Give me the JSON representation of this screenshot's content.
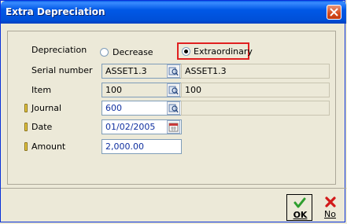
{
  "window": {
    "title": "Extra Depreciation"
  },
  "depreciation": {
    "label": "Depreciation",
    "options": [
      "Decrease",
      "Extraordinary"
    ],
    "selected": "Extraordinary"
  },
  "fields": {
    "serial_number": {
      "label": "Serial number",
      "value": "ASSET1.3",
      "description": "ASSET1.3"
    },
    "item": {
      "label": "Item",
      "value": "100",
      "description": "100"
    },
    "journal": {
      "label": "Journal",
      "value": "600",
      "description": ""
    },
    "date": {
      "label": "Date",
      "value": "01/02/2005"
    },
    "amount": {
      "label": "Amount",
      "value": "2,000.00"
    }
  },
  "buttons": {
    "ok": "OK",
    "no": "No"
  },
  "colors": {
    "highlight": "#e02020",
    "titlebar": "#0058e6",
    "required_marker": "#e1c23c"
  }
}
